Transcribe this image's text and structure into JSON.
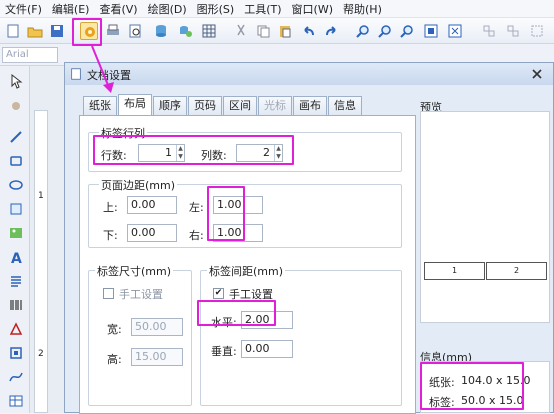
{
  "menu": [
    "文件(F)",
    "编辑(E)",
    "查看(V)",
    "绘图(D)",
    "图形(S)",
    "工具(T)",
    "窗口(W)",
    "帮助(H)"
  ],
  "font_combo": "Arial",
  "dialog": {
    "title": "文档设置",
    "tabs": [
      "纸张",
      "布局",
      "顺序",
      "页码",
      "区间",
      "光标",
      "画布",
      "信息"
    ],
    "label_rows_cols": {
      "title": "标签行列",
      "rows_label": "行数:",
      "rows_value": "1",
      "cols_label": "列数:",
      "cols_value": "2"
    },
    "page_margins": {
      "title": "页面边距(mm)",
      "top_label": "上:",
      "top_value": "0.00",
      "left_label": "左:",
      "left_value": "1.00",
      "bottom_label": "下:",
      "bottom_value": "0.00",
      "right_label": "右:",
      "right_value": "1.00"
    },
    "label_size": {
      "title": "标签尺寸(mm)",
      "manual_label": "手工设置",
      "manual_checked": false,
      "width_label": "宽:",
      "width_value": "50.00",
      "height_label": "高:",
      "height_value": "15.00"
    },
    "label_spacing": {
      "title": "标签间距(mm)",
      "manual_label": "手工设置",
      "manual_checked": true,
      "h_label": "水平:",
      "h_value": "2.00",
      "v_label": "垂直:",
      "v_value": "0.00"
    },
    "preview": {
      "title": "预览",
      "cells": [
        "1",
        "2"
      ]
    },
    "info": {
      "title": "信息(mm)",
      "paper_label": "纸张:",
      "paper_value": "104.0 x 15.0",
      "label_label": "标签:",
      "label_value": "50.0 x 15.0"
    }
  },
  "ruler_marks": [
    "1",
    "2"
  ],
  "colors": {
    "highlight": "#e020d8",
    "accent": "#2b63b8"
  }
}
